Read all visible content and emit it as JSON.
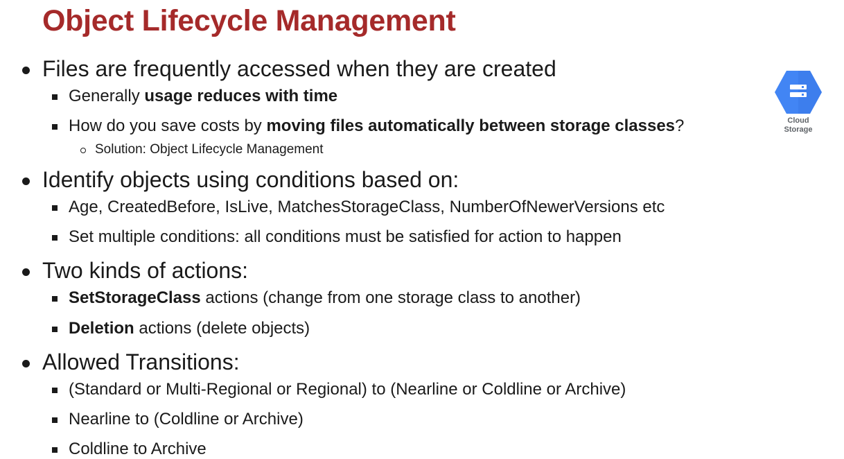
{
  "slide": {
    "title": "Object Lifecycle Management"
  },
  "logo": {
    "icon": "cloud-storage-icon",
    "label_line1": "Cloud",
    "label_line2": "Storage",
    "color": "#4285F4"
  },
  "bullets": {
    "b1": {
      "text": "Files are frequently accessed when they are created",
      "sub1": {
        "pre": "Generally ",
        "bold": "usage reduces with time",
        "post": ""
      },
      "sub2": {
        "pre": "How do you save costs by ",
        "bold": "moving files automatically between storage classes",
        "post": "?"
      },
      "sub2_child": "Solution: Object Lifecycle Management"
    },
    "b2": {
      "text": "Identify objects using conditions based on:",
      "sub1": "Age, CreatedBefore, IsLive, MatchesStorageClass, NumberOfNewerVersions etc",
      "sub2": "Set multiple conditions: all conditions must be satisfied for action to happen"
    },
    "b3": {
      "text": "Two kinds of actions:",
      "sub1": {
        "bold": "SetStorageClass",
        "post": " actions (change from one storage class to another)"
      },
      "sub2": {
        "bold": "Deletion",
        "post": " actions (delete objects)"
      }
    },
    "b4": {
      "text": "Allowed Transitions:",
      "sub1": "(Standard or Multi-Regional or Regional) to (Nearline or Coldline or Archive)",
      "sub2": "Nearline to (Coldline or Archive)",
      "sub3": "Coldline to Archive"
    }
  }
}
